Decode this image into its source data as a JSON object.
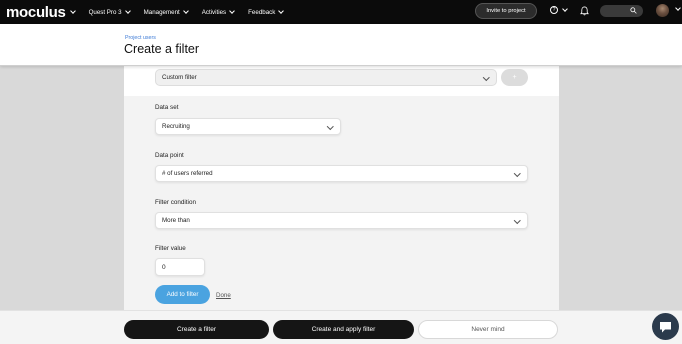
{
  "nav": {
    "logo": "moculus",
    "items": [
      {
        "label": "Quest Pro 3"
      },
      {
        "label": "Management"
      },
      {
        "label": "Activities"
      },
      {
        "label": "Feedback"
      }
    ],
    "invite_label": "Invite to project",
    "help_glyph": "?"
  },
  "header": {
    "breadcrumb": "Project users",
    "title": "Create a filter"
  },
  "form": {
    "filter_type": "Custom filter",
    "small_btn_label": "+",
    "data_set_label": "Data set",
    "data_set_value": "Recruiting",
    "data_point_label": "Data point",
    "data_point_value": "# of users referred",
    "condition_label": "Filter condition",
    "condition_value": "More than",
    "value_label": "Filter value",
    "value": "0",
    "add_label": "Add to filter",
    "done_label": "Done"
  },
  "footer": {
    "create_label": "Create a filter",
    "create_apply_label": "Create and apply filter",
    "cancel_label": "Never mind"
  },
  "colors": {
    "accent": "#4aa3e0",
    "link": "#3e7bd6",
    "nav_bg": "#0b0b0b"
  }
}
